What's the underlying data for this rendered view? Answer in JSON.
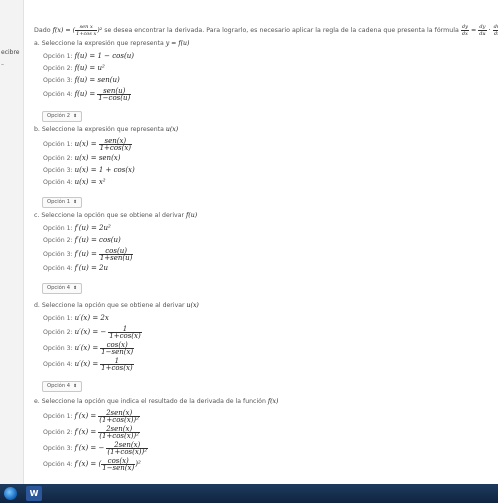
{
  "sidebar": {
    "label": "ecibre",
    "mark": "–"
  },
  "intro": {
    "prefix": "Dado",
    "suffix": "se desea encontrar la derivada. Para lograrlo, es necesario aplicar la regla de la cadena que presenta la fórmula"
  },
  "sections": [
    {
      "question": "a. Seleccione la expresión que representa",
      "question_math": "y = f(u)",
      "options": [
        {
          "label": "Opción 1:",
          "math": "f(u) = 1 − cos(u)"
        },
        {
          "label": "Opción 2:",
          "math": "f(u) = u²"
        },
        {
          "label": "Opción 3:",
          "math": "f(u) = sen(u)"
        },
        {
          "label": "Opción 4:",
          "math": "f(u) ="
        }
      ],
      "frac4": {
        "num": "sen(u)",
        "den": "1−cos(u)"
      },
      "selected": "Opción 2"
    },
    {
      "question": "b. Seleccione la expresión que representa",
      "question_math": "u(x)",
      "options": [
        {
          "label": "Opción 1:",
          "math": "u(x) ="
        },
        {
          "label": "Opción 2:",
          "math": "u(x) = sen(x)"
        },
        {
          "label": "Opción 3:",
          "math": "u(x) = 1 + cos(x)"
        },
        {
          "label": "Opción 4:",
          "math": "u(x) = x²"
        }
      ],
      "frac1": {
        "num": "sen(x)",
        "den": "1+cos(x)"
      },
      "selected": "Opción 1"
    },
    {
      "question": "c. Seleccione la opción que se obtiene al derivar",
      "question_math": "f(u)",
      "options": [
        {
          "label": "Opción 1:",
          "math": "f′(u) = 2u²"
        },
        {
          "label": "Opción 2:",
          "math": "f′(u) = cos(u)"
        },
        {
          "label": "Opción 3:",
          "math": "f′(u) ="
        },
        {
          "label": "Opción 4:",
          "math": "f′(u) = 2u"
        }
      ],
      "frac3": {
        "num": "cos(u)",
        "den": "1+sen(u)"
      },
      "selected": "Opción 4"
    },
    {
      "question": "d. Seleccione la opción que se obtiene al derivar",
      "question_math": "u(x)",
      "options": [
        {
          "label": "Opción 1:",
          "math": "u′(x) = 2x"
        },
        {
          "label": "Opción 2:",
          "math": "u′(x) = −"
        },
        {
          "label": "Opción 3:",
          "math": "u′(x) ="
        },
        {
          "label": "Opción 4:",
          "math": "u′(x) ="
        }
      ],
      "frac2": {
        "num": "1",
        "den": "1+cos(x)"
      },
      "frac3": {
        "num": "cos(x)",
        "den": "1−sen(x)"
      },
      "frac4": {
        "num": "1",
        "den": "1+cos(x)"
      },
      "selected": "Opción 4"
    },
    {
      "question": "e. Seleccione la opción que indica el resultado de la derivada de la función",
      "question_math": "f(x)",
      "options": [
        {
          "label": "Opción 1:",
          "math": "f′(x) ="
        },
        {
          "label": "Opción 2:",
          "math": "f′(x) ="
        },
        {
          "label": "Opción 3:",
          "math": "f′(x) = −"
        },
        {
          "label": "Opción 4:",
          "math": "f′(x) = ("
        }
      ],
      "frac1": {
        "num": "2sen(x)",
        "den": "(1+cos(x))²"
      },
      "frac2": {
        "num": "2sen(x)",
        "den": "(1+cos(x))²"
      },
      "frac3": {
        "num": "2sen(x)",
        "den": "(1+cos(x))²"
      },
      "frac4": {
        "num": "cos(x)",
        "den": "1−sen(x)"
      }
    }
  ],
  "select_caret": "⬍",
  "taskbar": {
    "app_letter": "W"
  }
}
